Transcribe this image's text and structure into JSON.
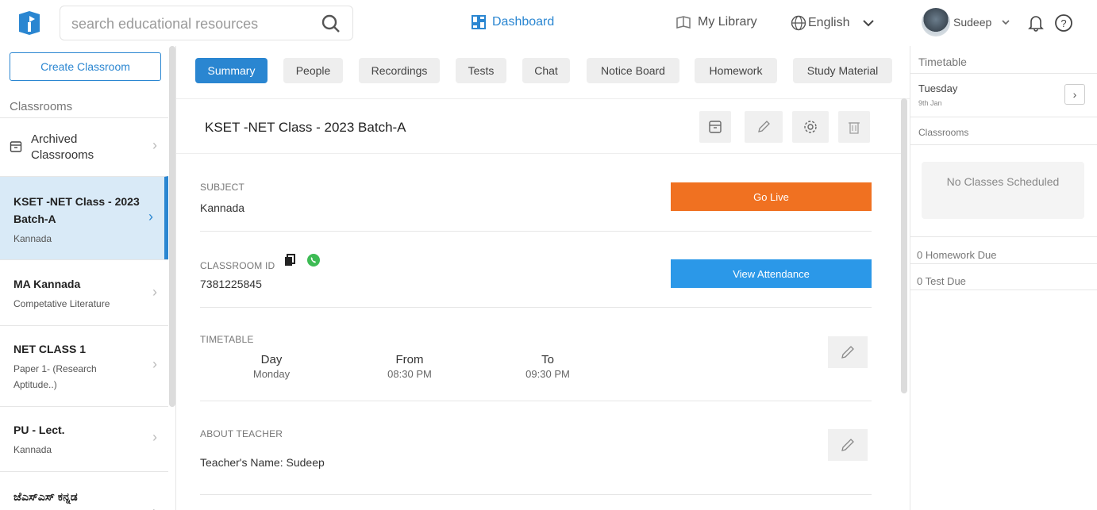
{
  "header": {
    "search_placeholder": "search educational resources",
    "dashboard_label": "Dashboard",
    "library_label": "My Library",
    "language_label": "English",
    "user_name": "Sudeep"
  },
  "sidebar": {
    "create_button": "Create Classroom",
    "section_title": "Classrooms",
    "archived": "Archived Classrooms",
    "items": [
      {
        "title": "KSET -NET Class - 2023 Batch-A",
        "subtitle": "Kannada"
      },
      {
        "title": "MA Kannada",
        "subtitle": "Competative Literature"
      },
      {
        "title": "NET CLASS 1",
        "subtitle": "Paper 1- (Research Aptitude..)"
      },
      {
        "title": "PU - Lect.",
        "subtitle": "Kannada"
      },
      {
        "title": "ಜೆಎಸ್ಎಸ್ ಕನ್ನಡ",
        "subtitle": ""
      }
    ]
  },
  "tabs": [
    "Summary",
    "People",
    "Recordings",
    "Tests",
    "Chat",
    "Notice Board",
    "Homework",
    "Study Material"
  ],
  "classroom": {
    "title": "KSET -NET Class - 2023 Batch-A",
    "subject_label": "SUBJECT",
    "subject": "Kannada",
    "go_live": "Go Live",
    "id_label": "CLASSROOM ID",
    "id": "7381225845",
    "view_attendance": "View Attendance",
    "timetable_label": "TIMETABLE",
    "tt_day_h": "Day",
    "tt_from_h": "From",
    "tt_to_h": "To",
    "tt_day": "Monday",
    "tt_from": "08:30 PM",
    "tt_to": "09:30 PM",
    "about_label": "ABOUT TEACHER",
    "teacher": "Teacher's Name: Sudeep"
  },
  "right_panel": {
    "title": "Timetable",
    "day": "Tuesday",
    "date": "9th Jan",
    "classrooms_label": "Classrooms",
    "no_classes": "No Classes Scheduled",
    "homework_due": "0 Homework Due",
    "test_due": "0 Test Due"
  },
  "colors": {
    "accent": "#2a86d1",
    "live": "#f07121",
    "attendance": "#2b98e8",
    "active_bg": "#d9eaf7"
  }
}
